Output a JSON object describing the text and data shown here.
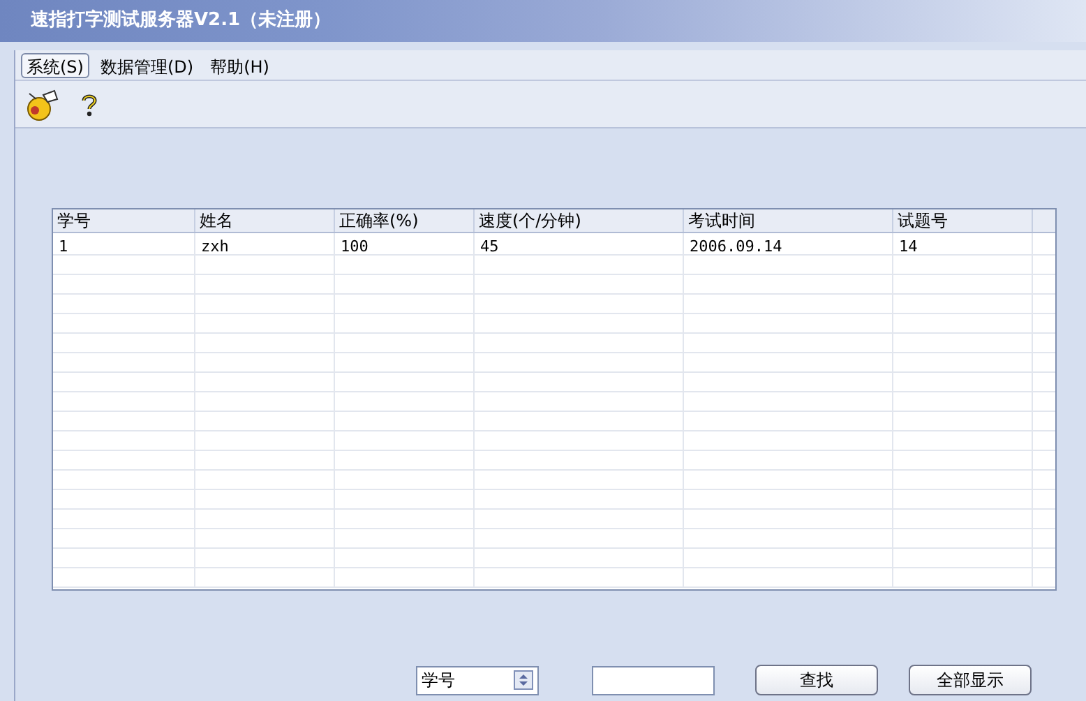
{
  "window": {
    "title": "速指打字测试服务器V2.1（未注册）"
  },
  "menu": [
    {
      "label": "系统(S)",
      "selected": true
    },
    {
      "label": "数据管理(D)",
      "selected": false
    },
    {
      "label": "帮助(H)",
      "selected": false
    }
  ],
  "toolbar": [
    {
      "kind": "bee"
    },
    {
      "kind": "help"
    }
  ],
  "table": {
    "columns": [
      "学号",
      "姓名",
      "正确率(%)",
      "速度(个/分钟)",
      "考试时间",
      "试题号"
    ],
    "rows": [
      [
        "1",
        "zxh",
        "100",
        "45",
        "2006.09.14",
        "14"
      ]
    ]
  },
  "search": {
    "field": "学号",
    "buttons": [
      "查找",
      "全部显示"
    ]
  }
}
